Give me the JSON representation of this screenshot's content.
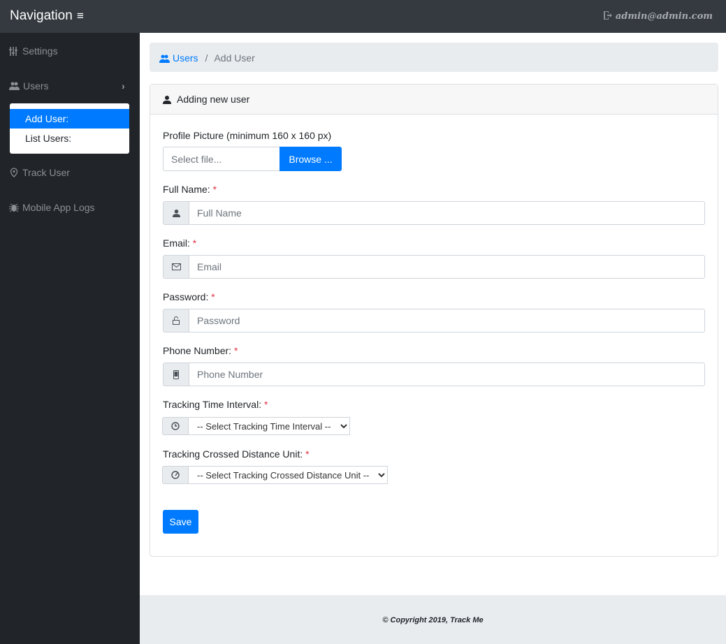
{
  "header": {
    "brand": "Navigation",
    "menu_icon": "≡",
    "user_email": "admin@admin.com"
  },
  "sidebar": {
    "items": [
      {
        "label": "Settings"
      },
      {
        "label": "Users"
      },
      {
        "label": "Track User"
      },
      {
        "label": "Mobile App Logs"
      }
    ],
    "users_submenu": [
      {
        "label": "Add User:"
      },
      {
        "label": "List Users:"
      }
    ]
  },
  "breadcrumb": {
    "parent": "Users",
    "separator": "/",
    "current": "Add User"
  },
  "card": {
    "title": "Adding new user"
  },
  "form": {
    "profile_label": "Profile Picture (minimum 160 x 160 px)",
    "file_placeholder": "Select file...",
    "browse_label": "Browse ...",
    "required_mark": "*",
    "full_name": {
      "label": "Full Name:",
      "placeholder": "Full Name",
      "value": ""
    },
    "email": {
      "label": "Email:",
      "placeholder": "Email",
      "value": ""
    },
    "password": {
      "label": "Password:",
      "placeholder": "Password",
      "value": ""
    },
    "phone": {
      "label": "Phone Number:",
      "placeholder": "Phone Number",
      "value": ""
    },
    "interval": {
      "label": "Tracking Time Interval:",
      "selected": "-- Select Tracking Time Interval --"
    },
    "distance": {
      "label": "Tracking Crossed Distance Unit:",
      "selected": "-- Select Tracking Crossed Distance Unit --"
    },
    "save_label": "Save"
  },
  "footer": {
    "text": "© Copyright 2019, Track Me"
  }
}
